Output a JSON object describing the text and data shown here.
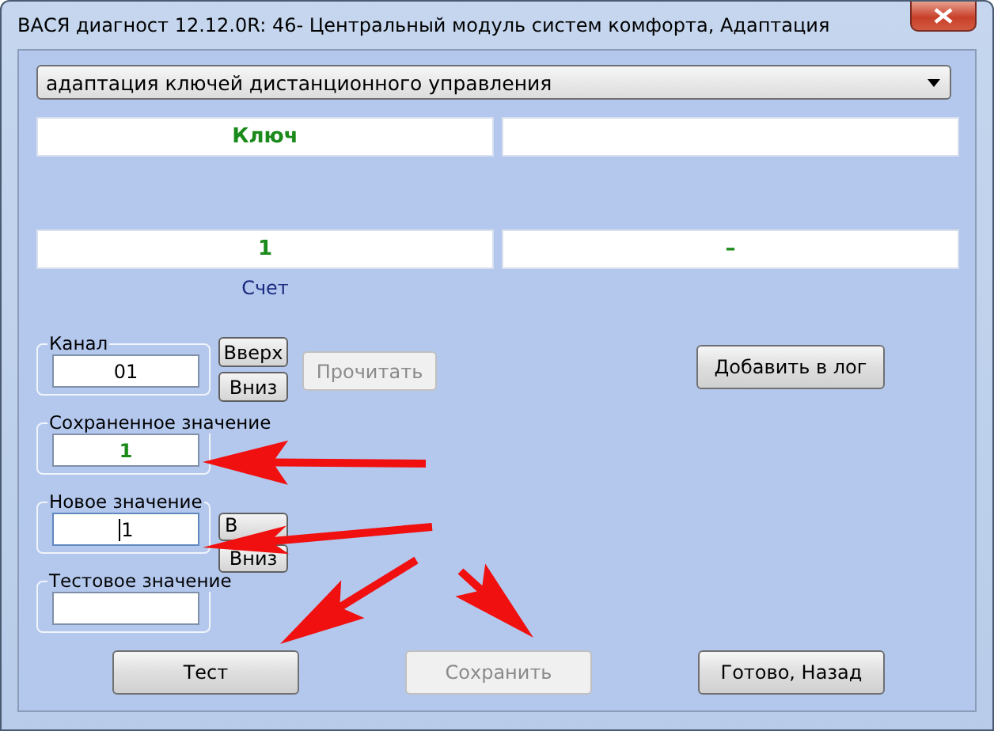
{
  "window": {
    "title": "ВАСЯ диагност 12.12.0R: 46- Центральный модуль систем комфорта, Адаптация"
  },
  "mode_select": {
    "value": "адаптация ключей дистанционного управления"
  },
  "columns": [
    {
      "header": "Ключ",
      "value": "1",
      "caption": "Счет"
    },
    {
      "value": "–"
    }
  ],
  "channel": {
    "label": "Канал",
    "value": "01",
    "up": "Вверх",
    "down": "Вниз"
  },
  "read_button": {
    "label": "Прочитать",
    "disabled": true
  },
  "log_button": {
    "label": "Добавить в лог",
    "disabled": false
  },
  "saved_value": {
    "label": "Сохраненное значение",
    "value": "1"
  },
  "new_value": {
    "label": "Новое значение",
    "value": "1",
    "focused": true,
    "up": "В",
    "down": "Вниз"
  },
  "test_value": {
    "label": "Тестовое значение"
  },
  "buttons": [
    {
      "label": "Тест",
      "disabled": false
    },
    {
      "label": "Сохранить",
      "disabled": true
    },
    {
      "label": "Готово, Назад",
      "disabled": false
    }
  ]
}
